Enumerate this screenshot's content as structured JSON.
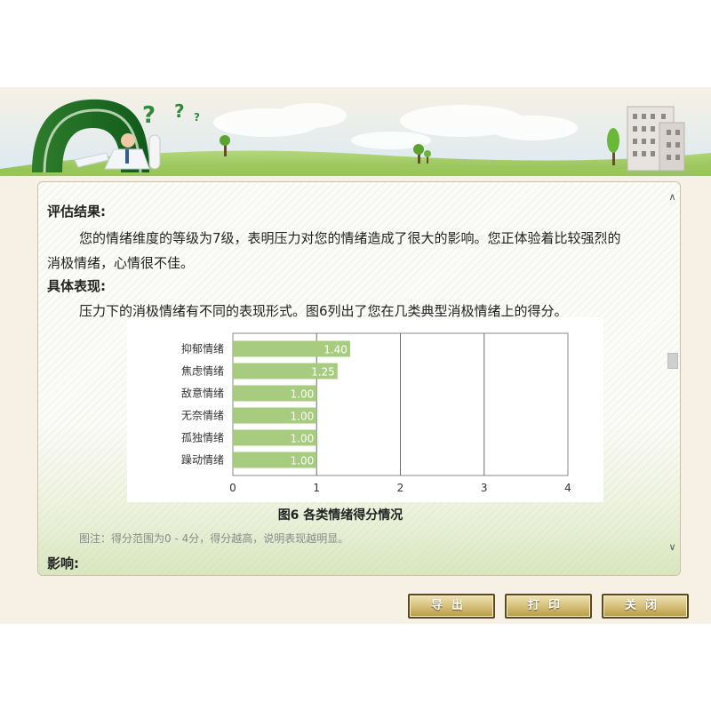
{
  "report": {
    "heading_result": "评估结果:",
    "result_line1": "您的情绪维度的等级为7级，表明压力对您的情绪造成了很大的影响。您正体验着比较强烈的",
    "result_line2": "消极情绪，心情很不佳。",
    "heading_symptoms": "具体表现:",
    "symptoms_text": "压力下的消极情绪有不同的表现形式。图6列出了您在几类典型消极情绪上的得分。",
    "chart_caption": "图6 各类情绪得分情况",
    "chart_note": "图注：得分范围为0 - 4分，得分越高，说明表现越明显。",
    "heading_influence": "影响:"
  },
  "chart_data": {
    "type": "bar",
    "orientation": "horizontal",
    "categories": [
      "抑郁情绪",
      "焦虑情绪",
      "敌意情绪",
      "无奈情绪",
      "孤独情绪",
      "躁动情绪"
    ],
    "values": [
      1.4,
      1.25,
      1.0,
      1.0,
      1.0,
      1.0
    ],
    "data_labels": [
      "1.40",
      "1.25",
      "1.00",
      "1.00",
      "1.00",
      "1.00"
    ],
    "xlim": [
      0,
      4
    ],
    "xticks": [
      "0",
      "1",
      "2",
      "3",
      "4"
    ],
    "bar_color": "#a7cc7f",
    "grid": true
  },
  "scrollbar": {
    "up_icon": "chevron-up-icon",
    "down_icon": "chevron-down-icon",
    "up_glyph": "∧",
    "down_glyph": "∨"
  },
  "buttons": {
    "export_label": "导出",
    "print_label": "打印",
    "close_label": "关闭"
  },
  "colors": {
    "banner_green": "#8fc24f",
    "sky": "#dcecf6",
    "button_gold": "#d6c07c",
    "button_border": "#5b4a1c"
  }
}
